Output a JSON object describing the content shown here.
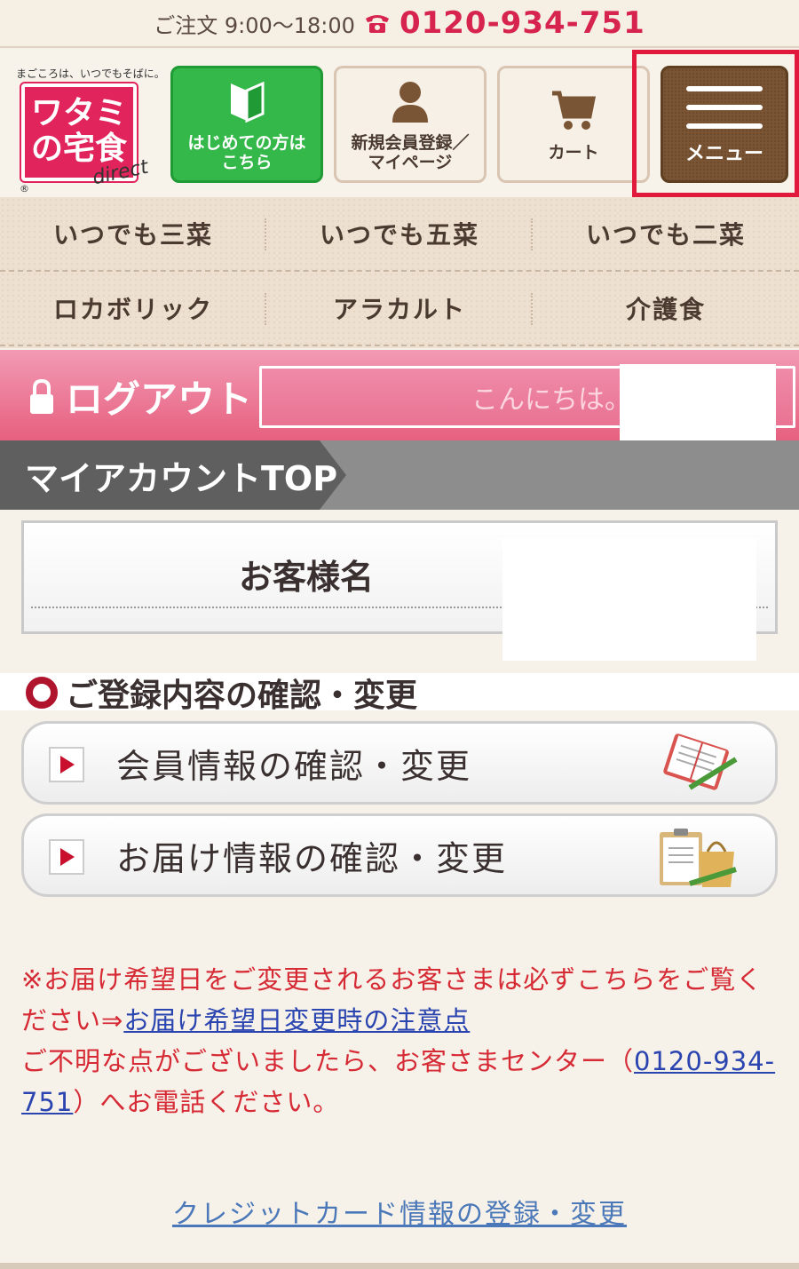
{
  "topbar": {
    "hours": "ご注文 9:00〜18:00",
    "phone": "0120-934-751"
  },
  "logo": {
    "tagline": "まごころは、いつでもそばに。",
    "line1": "ワタミ",
    "line2": "の宅食",
    "direct": "direct",
    "reg": "®"
  },
  "header_buttons": {
    "first": "はじめての方は\nこちら",
    "register": "新規会員登録／\nマイページ",
    "cart": "カート",
    "menu": "メニュー"
  },
  "categories": [
    [
      "いつでも三菜",
      "いつでも五菜",
      "いつでも二菜"
    ],
    [
      "ロカボリック",
      "アラカルト",
      "介護食"
    ]
  ],
  "logout": {
    "label": "ログアウト",
    "greeting": "こんにちは。"
  },
  "account": {
    "tab": "マイアカウントTOP",
    "customer_label": "お客様名"
  },
  "section": {
    "title": "ご登録内容の確認・変更",
    "links": [
      "会員情報の確認・変更",
      "お届け情報の確認・変更"
    ]
  },
  "notice": {
    "line1": "※お届け希望日をご変更されるお客さまは必ずこちらをご覧ください⇒",
    "link1": "お届け希望日変更時の注意点",
    "line2": "ご不明な点がございましたら、お客さまセンター（",
    "phone_link": "0120-934-751",
    "line3": "）へお電話ください。"
  },
  "credit_link": "クレジットカード情報の登録・変更",
  "colors": {
    "brand_pink": "#e1245c",
    "phone_red": "#d6244f",
    "green": "#35b84a",
    "menu_brown": "#7a5535",
    "highlight_red": "#e0193d",
    "notice_red": "#d62a35",
    "link_blue": "#2a44b0"
  }
}
